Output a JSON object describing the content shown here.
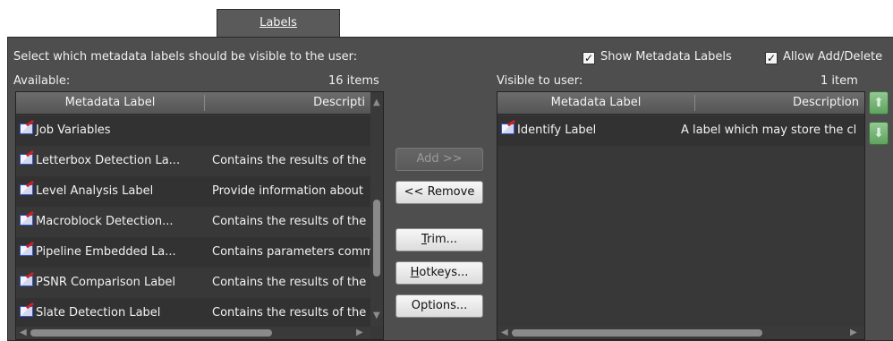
{
  "tab": {
    "label": "Labels"
  },
  "panel": {
    "instruction": "Select which metadata labels should be visible to the user:",
    "show_metadata_labels": {
      "label": "Show Metadata Labels",
      "checked": true
    },
    "allow_add_delete": {
      "label": "Allow Add/Delete",
      "checked": true
    }
  },
  "available": {
    "title": "Available:",
    "count": "16 items",
    "columns": [
      "Metadata Label",
      "Descripti"
    ],
    "rows": [
      {
        "label": "Job Variables",
        "description": ""
      },
      {
        "label": "Letterbox Detection La...",
        "description": "Contains the results of the"
      },
      {
        "label": "Level Analysis Label",
        "description": "Provide information about"
      },
      {
        "label": "Macroblock Detection...",
        "description": "Contains the results of the"
      },
      {
        "label": "Pipeline Embedded La...",
        "description": "Contains parameters comm"
      },
      {
        "label": "PSNR Comparison Label",
        "description": "Contains the results of the"
      },
      {
        "label": "Slate Detection Label",
        "description": "Contains the results of the"
      }
    ]
  },
  "visible": {
    "title": "Visible to user:",
    "count": "1 item",
    "columns": [
      "Metadata Label",
      "Description"
    ],
    "rows": [
      {
        "label": "Identify Label",
        "description": "A label which may store the cl"
      }
    ]
  },
  "buttons": {
    "add": "Add >>",
    "remove": "<< Remove",
    "trim": "Trim...",
    "hotkeys": "Hotkeys...",
    "options": "Options..."
  },
  "icons": {
    "label_icon": "metadata-label-icon",
    "move_up": "arrow-up-icon",
    "move_down": "arrow-down-icon"
  },
  "colors": {
    "panel": "#4e4e4e",
    "list": "#383838",
    "accent_green": "#6fb46f"
  }
}
